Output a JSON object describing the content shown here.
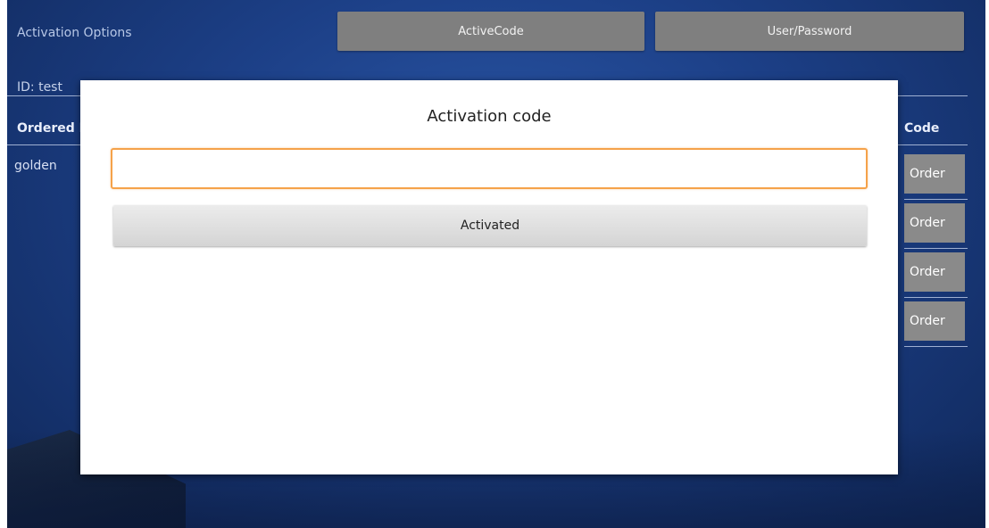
{
  "background": {
    "title": "Activation Options",
    "tabs": {
      "active_code": "ActiveCode",
      "user_password": "User/Password"
    },
    "id_label": "ID: test",
    "columns": {
      "ordered": "Ordered P",
      "code": "Code"
    },
    "rows": [
      {
        "name": "golden",
        "order_label": "Order"
      },
      {
        "order_label": "Order"
      },
      {
        "order_label": "Order"
      },
      {
        "order_label": "Order"
      }
    ]
  },
  "dialog": {
    "title": "Activation code",
    "input_value": "",
    "button_label": "Activated"
  },
  "colors": {
    "accent_input_border": "#f5a24a",
    "background_blue": "#1c3f86"
  }
}
